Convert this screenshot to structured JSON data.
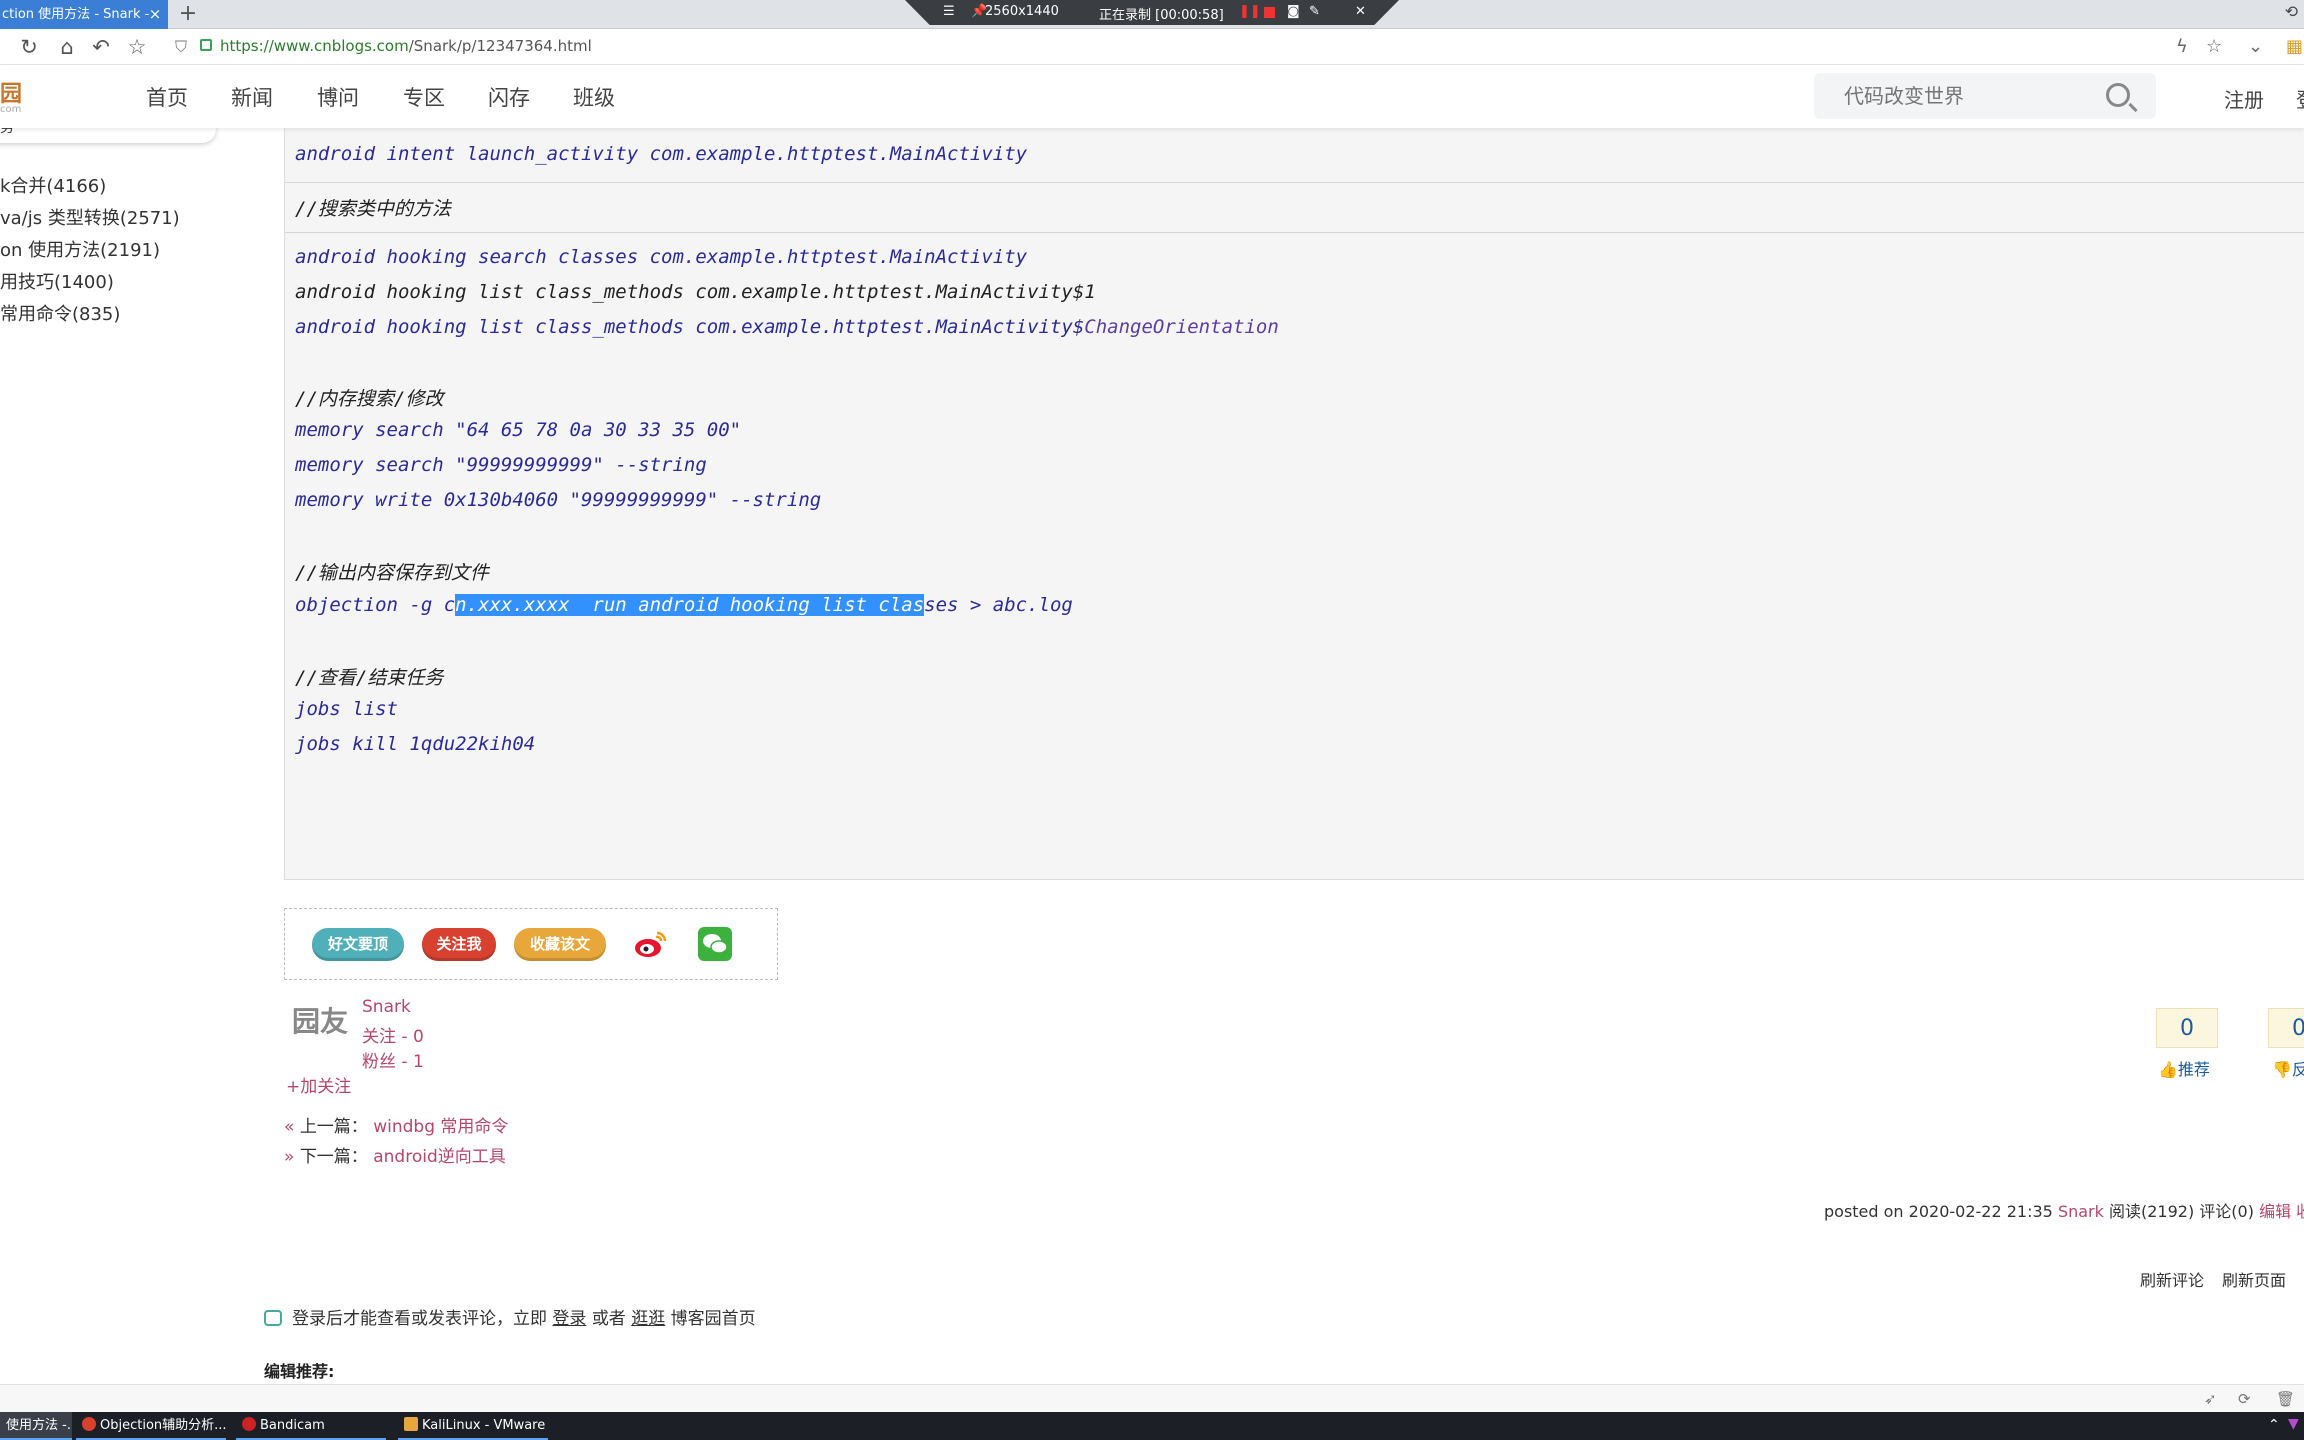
{
  "browser": {
    "tab_title": "ction 使用方法 - Snark -",
    "tab_close": "×",
    "new_tab": "+",
    "url_host": "https://www.cnblogs.com",
    "url_path": "/Snark/p/12347364.html"
  },
  "recorder": {
    "resolution": "2560x1440",
    "status": "正在录制 [00:00:58]"
  },
  "site": {
    "logo": "园",
    "logo_sub": "com",
    "nav": [
      "首页",
      "新闻",
      "博问",
      "专区",
      "闪存",
      "班级"
    ],
    "search_placeholder": "代码改变世界",
    "register": "注册",
    "login": "登"
  },
  "sidebar": {
    "card_label": "务",
    "items": [
      "k合并(4166)",
      "va/js 类型转换(2571)",
      "on 使用方法(2191)",
      "用技巧(1400)",
      " 常用命令(835)"
    ]
  },
  "code": {
    "line0": "android intent launch_activity com.example.httptest.MainActivity",
    "comment_classes": "//搜索类中的方法",
    "l1": "android hooking search classes com.example.httptest.MainActivity",
    "l2": "android hooking list class_methods com.example.httptest.MainActivity$1",
    "l3a": "android hooking list class_methods com.example.httptest.MainActivity$",
    "l3b": "ChangeOrientation",
    "comment_memory": "//内存搜索/修改",
    "m1": "memory search \"64 65 78 0a 30 33 35 00\"",
    "m2": "memory search \"99999999999\" --string",
    "m3": "memory write 0x130b4060 \"99999999999\" --string",
    "comment_output": "//输出内容保存到文件",
    "o1a": "objection -g c",
    "o1b": "n.xxx.xxxx  run android hooking list clas",
    "o1c": "ses > abc.log",
    "comment_jobs": "//查看/结束任务",
    "j1": "jobs list",
    "j2": "jobs kill 1qdu22kih04"
  },
  "share": {
    "good": "好文要顶",
    "follow": "关注我",
    "favorite": "收藏该文"
  },
  "author": {
    "avatar_text": "园友",
    "name": "Snark",
    "following": "关注 - 0",
    "followers": "粉丝 - 1",
    "add_follow": "+加关注"
  },
  "votes": {
    "digg_count": "0",
    "digg_label": "推荐",
    "bury_count": "0",
    "bury_label": "反"
  },
  "prevnext": {
    "prev_label": "上一篇：",
    "prev_link": "windbg 常用命令",
    "next_label": "下一篇：",
    "next_link": "android逆向工具"
  },
  "postinfo": {
    "posted": "posted on 2020-02-22 21:35",
    "author": "Snark",
    "reads": "阅读(2192)",
    "comments": "评论(0)",
    "edit": "编辑",
    "collect": "收"
  },
  "refresh": {
    "comments": "刷新评论",
    "page": "刷新页面"
  },
  "login_note": {
    "pre": "登录后才能查看或发表评论，立即",
    "login": "登录",
    "or": "或者",
    "browse": "逛逛",
    "post": "博客园首页"
  },
  "editor_pick": "编辑推荐:",
  "taskbar": {
    "items": [
      "使用方法 -...",
      "Objection辅助分析...",
      "Bandicam",
      "KaliLinux - VMware ..."
    ]
  },
  "colors": {
    "link": "#b7476a",
    "selection": "#3390ff",
    "share_green": "#4fb0b9",
    "share_red": "#d8412f",
    "share_yellow": "#e8a73a"
  }
}
